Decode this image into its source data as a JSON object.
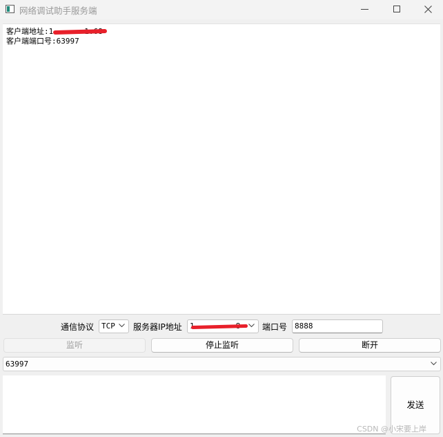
{
  "window": {
    "title": "网络调试助手服务端",
    "controls": {
      "minimize_icon": "minimize-icon",
      "maximize_icon": "maximize-icon",
      "close_icon": "close-icon"
    }
  },
  "log": {
    "lines": [
      {
        "label": "客户端地址:",
        "value": "1",
        "tail": "1.68",
        "redacted": true
      },
      {
        "label": "客户端端口号:",
        "value": "63997",
        "redacted": false
      }
    ]
  },
  "config": {
    "protocol_label": "通信协议",
    "protocol_value": "TCP",
    "server_ip_label": "服务器IP地址",
    "server_ip_value": "1",
    "server_ip_tail": "8",
    "server_ip_redacted": true,
    "port_label": "端口号",
    "port_value": "8888"
  },
  "buttons": {
    "listen": "监听",
    "stop_listen": "停止监听",
    "disconnect": "断开"
  },
  "client_select": {
    "value": "63997"
  },
  "send": {
    "input_value": "",
    "button_label": "发送"
  },
  "watermark": "CSDN @小宋要上岸",
  "colors": {
    "redaction": "#e8202a",
    "background": "#f0f0f0"
  }
}
